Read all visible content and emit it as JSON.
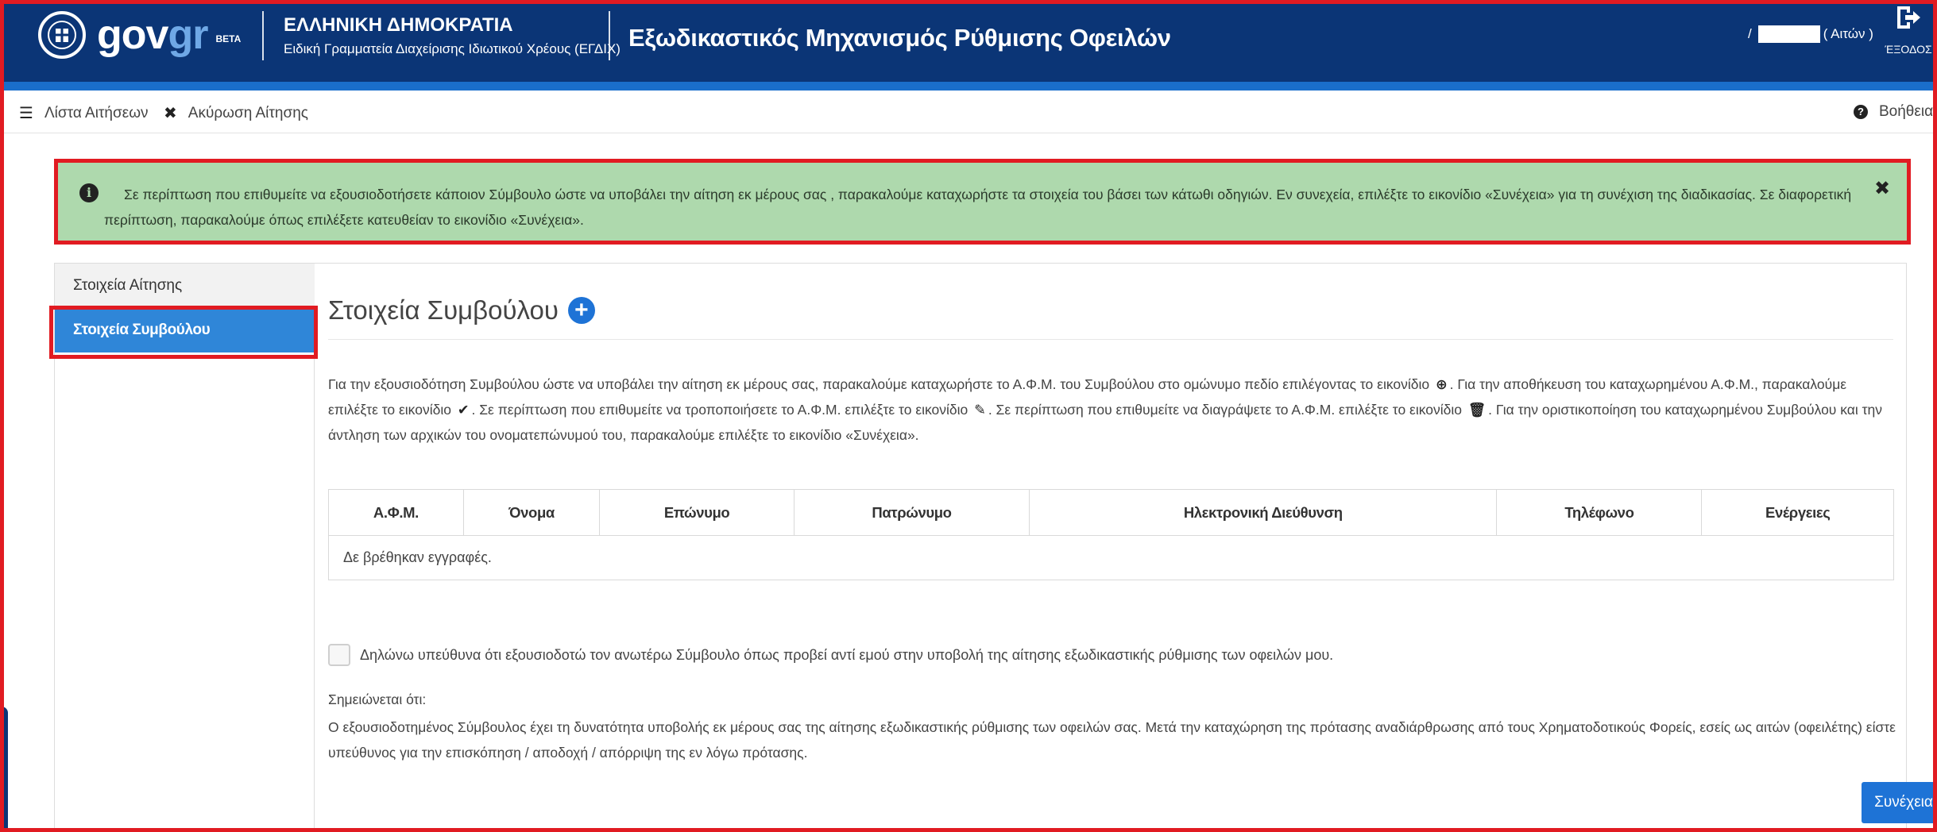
{
  "colors": {
    "header_bg": "#0b3576",
    "header_stripe": "#1a6ecb",
    "alert_bg": "#aed9ad",
    "highlight_border": "#e11b22",
    "active_tab_bg": "#2f86d8",
    "primary_button": "#1e73d6"
  },
  "header": {
    "logo_gov": "gov",
    "logo_gr": "gr",
    "logo_beta": "BETA",
    "gov_title": "ΕΛΛΗΝΙΚΗ ΔΗΜΟΚΡΑΤΙΑ",
    "gov_subtitle": "Ειδική Γραμματεία Διαχείρισης Ιδιωτικού Χρέους (ΕΓΔΙΧ)",
    "app_title": "Εξωδικαστικός Μηχανισμός Ρύθμισης Οφειλών",
    "user_prefix": "/",
    "user_role": "( Αιτών )",
    "logout_label": "ΈΞΟΔΟΣ",
    "icons": [
      "greek-emblem-icon",
      "logout-icon"
    ]
  },
  "toolbar": {
    "list_label": "Λίστα Αιτήσεων",
    "list_icon": "list-icon",
    "cancel_label": "Ακύρωση Αίτησης",
    "cancel_icon": "close-icon",
    "help_label": "Βοήθεια",
    "help_icon": "question-circle-icon"
  },
  "alert": {
    "icon": "info-circle-icon",
    "text": "Σε περίπτωση που επιθυμείτε να εξουσιοδοτήσετε κάποιον Σύμβουλο ώστε να υποβάλει την αίτηση εκ μέρους σας , παρακαλούμε καταχωρήστε τα στοιχεία του βάσει των κάτωθι οδηγιών. Εν συνεχεία, επιλέξτε το εικονίδιο «Συνέχεια» για τη συνέχιση της διαδικασίας. Σε διαφορετική περίπτωση, παρακαλούμε όπως επιλέξετε κατευθείαν το εικονίδιο «Συνέχεια».",
    "close_symbol": "✖"
  },
  "sidebar": {
    "items": [
      {
        "label": "Στοιχεία Αίτησης",
        "active": false
      },
      {
        "label": "Στοιχεία Συμβούλου",
        "active": true
      }
    ]
  },
  "main": {
    "section_title": "Στοιχεία Συμβούλου",
    "add_icon": "plus-circle-icon",
    "instructions": {
      "part1": "Για την εξουσιοδότηση Συμβούλου ώστε να υποβάλει την αίτηση εκ μέρους σας, παρακαλούμε καταχωρήστε το Α.Φ.Μ. του Συμβούλου στο ομώνυμο πεδίο επιλέγοντας το εικονίδιο",
      "part2": ". Για την αποθήκευση του καταχωρημένου Α.Φ.Μ., παρακαλούμε επιλέξτε το εικονίδιο",
      "part3": ". Σε περίπτωση που επιθυμείτε να τροποποιήσετε το Α.Φ.Μ. επιλέξτε το εικονίδιο",
      "part4": ". Σε περίπτωση που επιθυμείτε να διαγράψετε το Α.Φ.Μ. επιλέξτε το εικονίδιο",
      "part5": ". Για την οριστικοποίηση του καταχωρημένου Συμβούλου και την άντληση των αρχικών του ονοματεπώνυμού του, παρακαλούμε επιλέξτε το εικονίδιο «Συνέχεια».",
      "icons": [
        "plus-circle-icon",
        "check-icon",
        "pencil-icon",
        "trash-icon"
      ]
    },
    "table": {
      "columns": [
        "Α.Φ.Μ.",
        "Όνομα",
        "Επώνυμο",
        "Πατρώνυμο",
        "Ηλεκτρονική Διεύθυνση",
        "Τηλέφωνο",
        "Ενέργειες"
      ],
      "empty_message": "Δε βρέθηκαν εγγραφές."
    },
    "declaration": {
      "checked": false,
      "label": "Δηλώνω υπεύθυνα ότι εξουσιοδοτώ τον ανωτέρω Σύμβουλο όπως προβεί αντί εμού στην υποβολή της αίτησης εξωδικαστικής ρύθμισης των οφειλών μου."
    },
    "note_label": "Σημειώνεται ότι:",
    "note_text": "Ο εξουσιοδοτημένος Σύμβουλος έχει τη δυνατότητα υποβολής εκ μέρους σας της αίτησης εξωδικαστικής ρύθμισης των οφειλών σας. Μετά την καταχώρηση της πρότασης αναδιάρθρωσης από τους Χρηματοδοτικούς Φορείς, εσείς ως αιτών (οφειλέτης) είστε υπεύθυνος για την επισκόπηση / αποδοχή / απόρριψη της εν λόγω πρότασης.",
    "continue_label": "Συνέχεια"
  }
}
